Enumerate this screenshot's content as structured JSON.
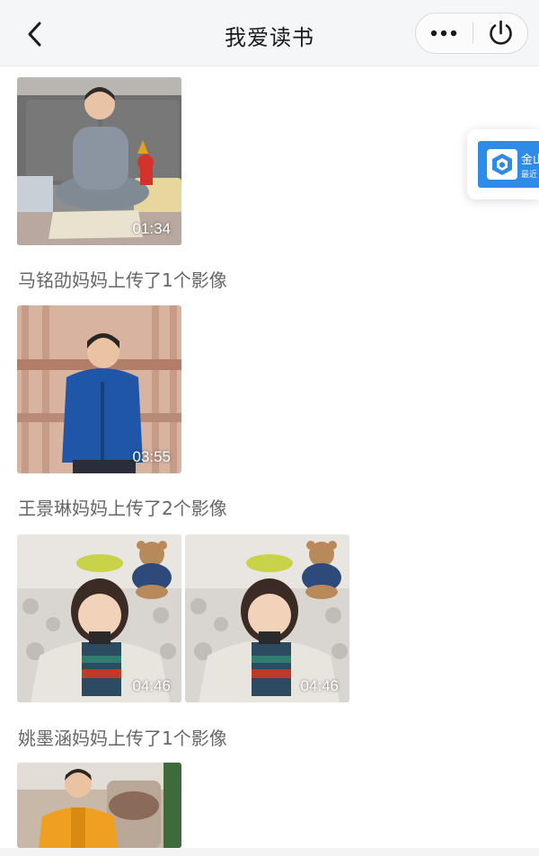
{
  "navbar": {
    "title": "我爱读书",
    "back_icon": "chevron-left-icon",
    "more_icon": "more-dots-icon",
    "power_icon": "power-icon"
  },
  "feed": {
    "items": [
      {
        "duration": "01:34"
      },
      {
        "caption": "马铭劭妈妈上传了1个影像",
        "duration": "03:55"
      },
      {
        "caption": "王景琳妈妈上传了2个影像",
        "durations": [
          "04:46",
          "04:46"
        ]
      },
      {
        "caption": "姚墨涵妈妈上传了1个影像"
      }
    ]
  },
  "floating_card": {
    "title": "金山",
    "subtitle": "最近"
  },
  "colors": {
    "navbar_bg": "#f5f6f8",
    "caption_text": "#666666",
    "card_blue": "#2f8be8"
  }
}
